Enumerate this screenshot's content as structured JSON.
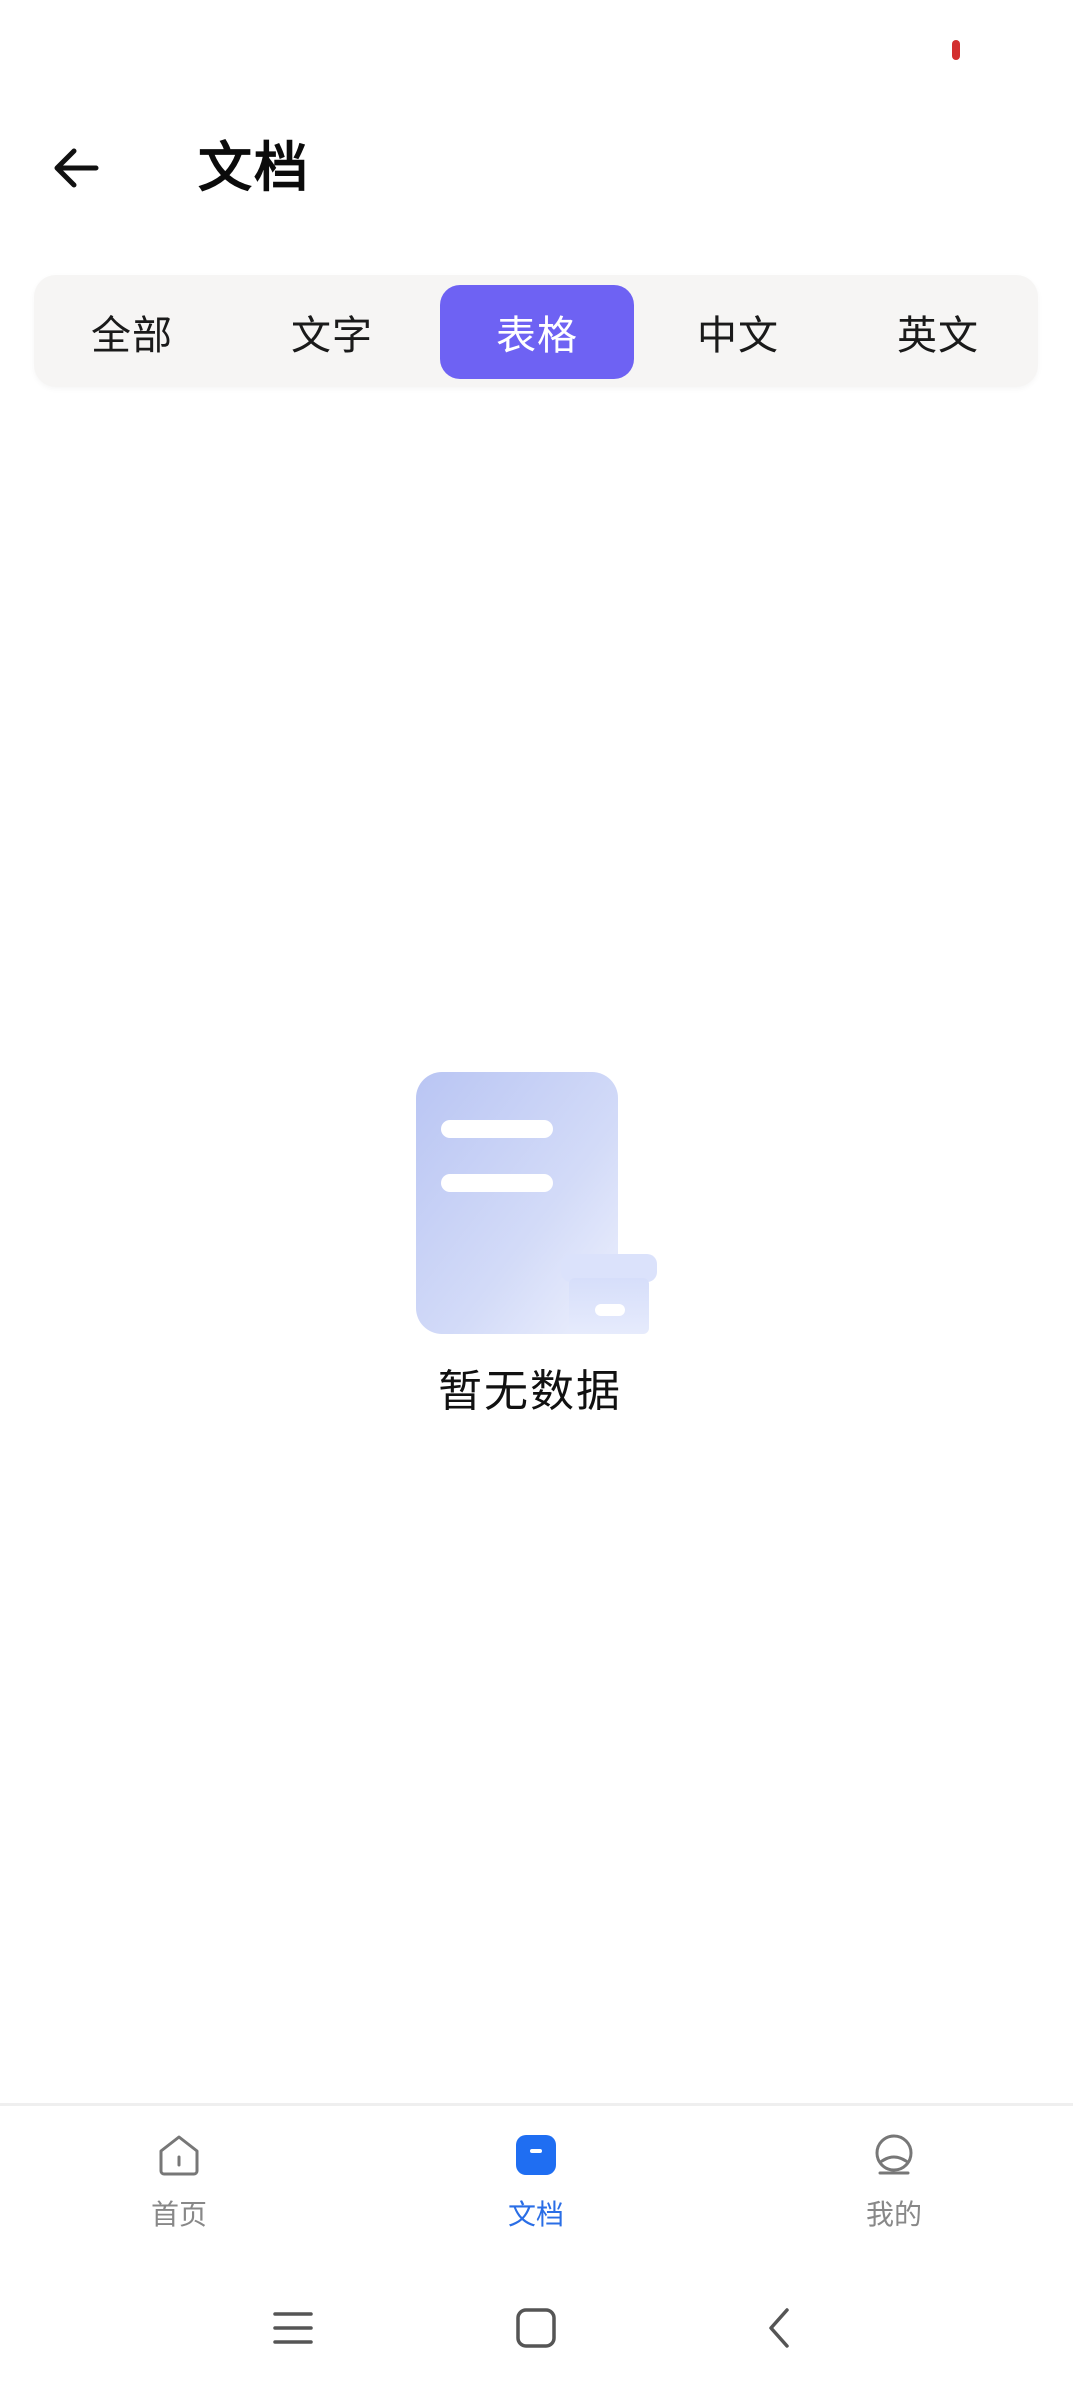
{
  "header": {
    "title": "文档",
    "back_icon": "arrow-left-icon"
  },
  "tabs": [
    {
      "label": "全部",
      "active": false
    },
    {
      "label": "文字",
      "active": false
    },
    {
      "label": "表格",
      "active": true
    },
    {
      "label": "中文",
      "active": false
    },
    {
      "label": "英文",
      "active": false
    }
  ],
  "empty_state": {
    "icon": "empty-document-box-icon",
    "message": "暂无数据"
  },
  "bottom_nav": {
    "items": [
      {
        "label": "首页",
        "icon": "home-icon",
        "active": false
      },
      {
        "label": "文档",
        "icon": "document-icon",
        "active": true
      },
      {
        "label": "我的",
        "icon": "profile-icon",
        "active": false
      }
    ]
  },
  "system_nav": {
    "menu_icon": "menu-icon",
    "home_icon": "square-home-icon",
    "back_icon": "chevron-left-icon"
  },
  "colors": {
    "accent": "#6e62f3",
    "nav_active": "#2a6ee6",
    "nav_inactive": "#888888",
    "status_indicator": "#d32f2f"
  }
}
